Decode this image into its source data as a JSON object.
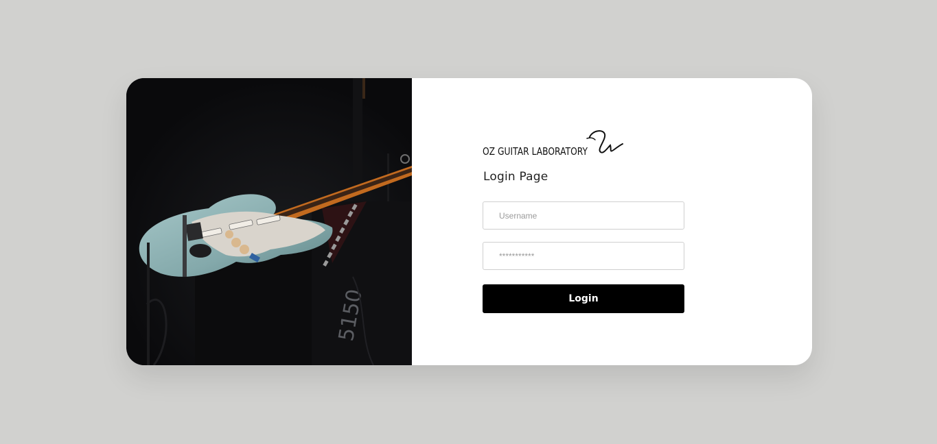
{
  "brand": {
    "name": "OZ GUITAR LABORATORY",
    "logo_icon": "signature-mark-icon"
  },
  "login": {
    "title": "Login Page",
    "username_placeholder": "Username",
    "password_placeholder": "***********",
    "button_label": "Login"
  },
  "hero_image": {
    "subject": "electric-guitar-photo-icon"
  },
  "colors": {
    "page_background": "#d1d1cf",
    "card_background": "#ffffff",
    "button_background": "#000000",
    "button_text": "#ffffff",
    "guitar_body": "#8fb3b5"
  }
}
